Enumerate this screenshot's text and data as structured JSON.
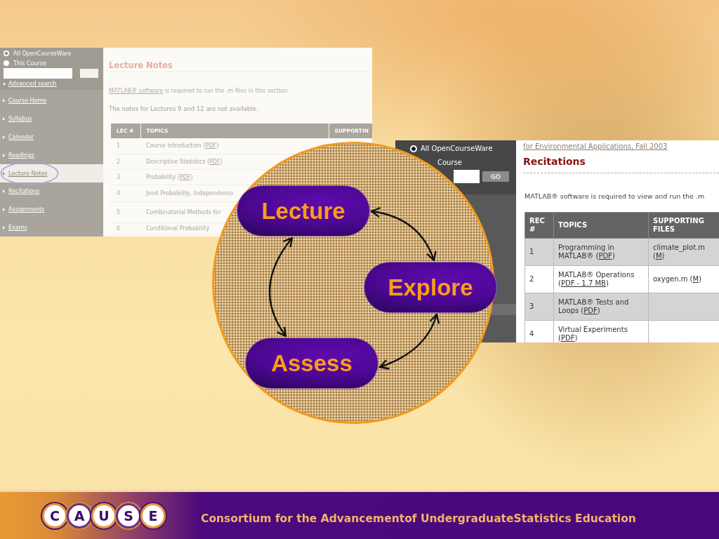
{
  "left_screenshot": {
    "search": {
      "options": [
        {
          "label": "All OpenCourseWare",
          "selected": true
        },
        {
          "label": "This Course",
          "selected": false
        }
      ],
      "advanced_link": "Advanced search"
    },
    "nav": [
      {
        "label": "Course Home",
        "selected": false,
        "circled": false
      },
      {
        "label": "Syllabus",
        "selected": false,
        "circled": false
      },
      {
        "label": "Calendar",
        "selected": false,
        "circled": false
      },
      {
        "label": "Readings",
        "selected": false,
        "circled": false
      },
      {
        "label": "Lecture Notes",
        "selected": true,
        "circled": true
      },
      {
        "label": "Recitations",
        "selected": false,
        "circled": false
      },
      {
        "label": "Assignments",
        "selected": false,
        "circled": false
      },
      {
        "label": "Exams",
        "selected": false,
        "circled": false
      }
    ],
    "title": "Lecture Notes",
    "intro": {
      "link": "MATLAB® software",
      "text": "is required to run the .m files in this section."
    },
    "note": "The notes for Lectures 9 and 12 are not available.",
    "table": {
      "columns": [
        "LEC #",
        "TOPICS",
        "SUPPORTIN"
      ],
      "rows": [
        {
          "number": "1",
          "topic": [
            {
              "kind": "text",
              "text": "Course Introduction ("
            },
            {
              "kind": "link",
              "text": "PDF"
            },
            {
              "kind": "text",
              "text": ")"
            }
          ]
        },
        {
          "number": "2",
          "topic": [
            {
              "kind": "text",
              "text": "Descriptive Statistics ("
            },
            {
              "kind": "link",
              "text": "PDF"
            },
            {
              "kind": "text",
              "text": ")"
            }
          ]
        },
        {
          "number": "3",
          "topic": [
            {
              "kind": "text",
              "text": "Probability ("
            },
            {
              "kind": "link",
              "text": "PDF"
            },
            {
              "kind": "text",
              "text": ")"
            }
          ]
        },
        {
          "number": "4",
          "topic": [
            {
              "kind": "text",
              "text": "Joint Probability, Independence"
            }
          ]
        },
        {
          "number": "5",
          "topic": [
            {
              "kind": "text",
              "text": "Combinatorial Methods for"
            }
          ]
        },
        {
          "number": "6",
          "topic": [
            {
              "kind": "text",
              "text": "Conditional Probability"
            }
          ]
        }
      ]
    }
  },
  "right_screenshot": {
    "search": {
      "options": [
        {
          "label": "All OpenCourseWare",
          "selected": true
        }
      ],
      "partial_option": "Course",
      "button": "GO"
    },
    "course_link": "for Environmental Applications, Fall 2003",
    "title": "Recitations",
    "intro": "MATLAB® software is required to view and run the .m",
    "table": {
      "columns": [
        "REC #",
        "TOPICS",
        "SUPPORTING FILES"
      ],
      "rows": [
        {
          "number": "1",
          "topic": [
            {
              "kind": "text",
              "text": "Programming in MATLAB® ("
            },
            {
              "kind": "link",
              "text": "PDF"
            },
            {
              "kind": "text",
              "text": ")"
            }
          ],
          "files": [
            {
              "kind": "text",
              "text": "climate_plot.m ("
            },
            {
              "kind": "link",
              "text": "M"
            },
            {
              "kind": "text",
              "text": ")"
            }
          ]
        },
        {
          "number": "2",
          "topic": [
            {
              "kind": "text",
              "text": "MATLAB® Operations ("
            },
            {
              "kind": "link",
              "text": "PDF - 1.7 MB"
            },
            {
              "kind": "text",
              "text": ")"
            }
          ],
          "files": [
            {
              "kind": "text",
              "text": "oxygen.m ("
            },
            {
              "kind": "link",
              "text": "M"
            },
            {
              "kind": "text",
              "text": ")"
            }
          ]
        },
        {
          "number": "3",
          "topic": [
            {
              "kind": "text",
              "text": "MATLAB® Tests and Loops ("
            },
            {
              "kind": "link",
              "text": "PDF"
            },
            {
              "kind": "text",
              "text": ")"
            }
          ]
        },
        {
          "number": "4",
          "topic": [
            {
              "kind": "text",
              "text": "Virtual Experiments ("
            },
            {
              "kind": "link",
              "text": "PDF"
            },
            {
              "kind": "text",
              "text": ")"
            }
          ]
        }
      ]
    }
  },
  "diagram": {
    "nodes": [
      {
        "label": "Lecture"
      },
      {
        "label": "Explore"
      },
      {
        "label": "Assess"
      }
    ],
    "links": [
      {
        "two_way": true
      },
      {
        "two_way": true
      },
      {
        "two_way": true
      }
    ]
  },
  "banner": {
    "logo_letters": [
      "C",
      "A",
      "U",
      "S",
      "E"
    ],
    "tagline": "Consortium for the Advancementof UndergraduateStatistics Education"
  }
}
